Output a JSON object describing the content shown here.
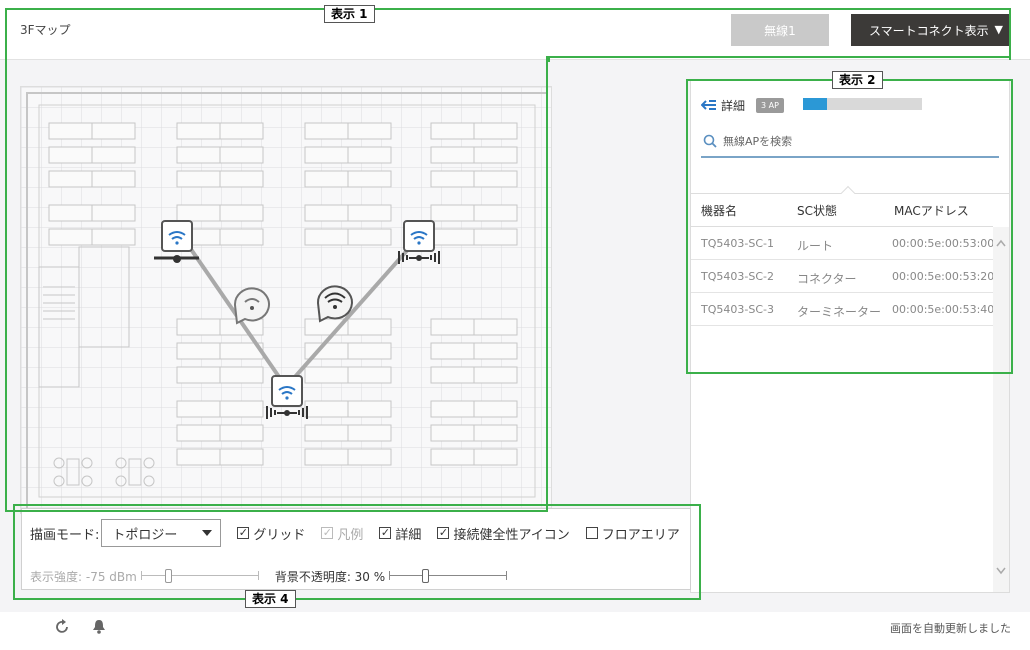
{
  "header": {
    "map_title": "3Fマップ",
    "wireless_button": "無線1",
    "smart_connect_button": "スマートコネクト表示",
    "caret": "▼"
  },
  "annotations": {
    "display1": "表示 1",
    "display2": "表示 2",
    "display4": "表示 4"
  },
  "map": {
    "aps": [
      {
        "icon": "wifi-ap-icon"
      },
      {
        "icon": "wifi-ap-icon"
      },
      {
        "icon": "wifi-ap-icon"
      }
    ],
    "status_bubbles": [
      {
        "icon": "wifi-weak-icon"
      },
      {
        "icon": "wifi-strong-icon"
      }
    ]
  },
  "panel": {
    "detail_label": "詳細",
    "ap_count_badge": "3 AP",
    "progress": 0.2,
    "search_placeholder": "無線APを検索",
    "columns": [
      "機器名",
      "SC状態",
      "MACアドレス"
    ],
    "rows": [
      {
        "name": "TQ5403-SC-1",
        "state": "ルート",
        "mac": "00:00:5e:00:53:00"
      },
      {
        "name": "TQ5403-SC-2",
        "state": "コネクター",
        "mac": "00:00:5e:00:53:20"
      },
      {
        "name": "TQ5403-SC-3",
        "state": "ターミネーター",
        "mac": "00:00:5e:00:53:40"
      }
    ]
  },
  "controls": {
    "draw_mode_label": "描画モード:",
    "draw_mode_value": "トポロジー",
    "grid": {
      "label": "グリッド",
      "checked": true
    },
    "legend": {
      "label": "凡例",
      "checked": true,
      "disabled": true
    },
    "details": {
      "label": "詳細",
      "checked": true
    },
    "health_icon": {
      "label": "接続健全性アイコン",
      "checked": true
    },
    "floor_area": {
      "label": "フロアエリア",
      "checked": false
    },
    "strength_label": "表示強度: -75 dBm",
    "strength_level": 0.22,
    "opacity_label": "背景不透明度: 30 %",
    "opacity_level": 0.3
  },
  "footer": {
    "status": "画面を自動更新しました",
    "refresh_icon": "refresh-icon",
    "bell_icon": "bell-icon"
  },
  "colors": {
    "accent_green": "#3bb04a",
    "accent_blue": "#2b98d6",
    "dark_button": "#3c3a38"
  }
}
